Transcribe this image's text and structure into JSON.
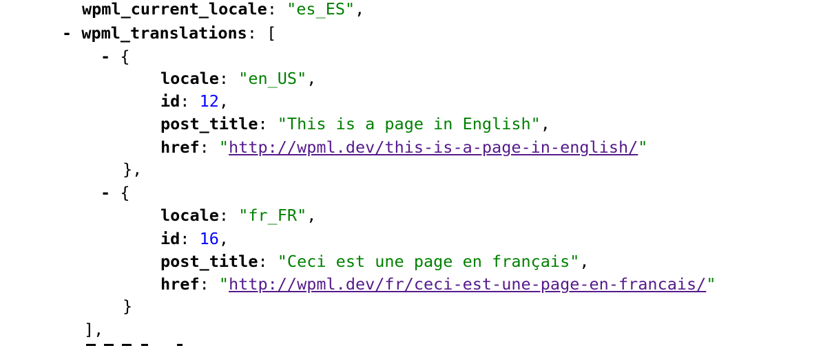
{
  "current_locale": {
    "key": "wpml_current_locale",
    "value": "\"es_ES\""
  },
  "translations": {
    "toggle": "-",
    "key": "wpml_translations",
    "open": "[",
    "close": "],",
    "items": [
      {
        "toggle": "-",
        "open": "{",
        "close": "},",
        "locale_key": "locale",
        "locale_value": "en_US",
        "id_key": "id",
        "id_value": "12",
        "title_key": "post_title",
        "title_value": "\"This is a page in English\"",
        "href_key": "href",
        "href_value": "http://wpml.dev/this-is-a-page-in-english/"
      },
      {
        "toggle": "-",
        "open": "{",
        "close": "}",
        "locale_key": "locale",
        "locale_value": "fr_FR",
        "id_key": "id",
        "id_value": "16",
        "title_key": "post_title",
        "title_value": "\"Ceci est une page en français\"",
        "href_key": "href",
        "href_value": "http://wpml.dev/fr/ceci-est-une-page-en-francais/"
      }
    ]
  },
  "colors": {
    "string": "#008000",
    "number": "#0000ff",
    "link": "#551a8b"
  }
}
